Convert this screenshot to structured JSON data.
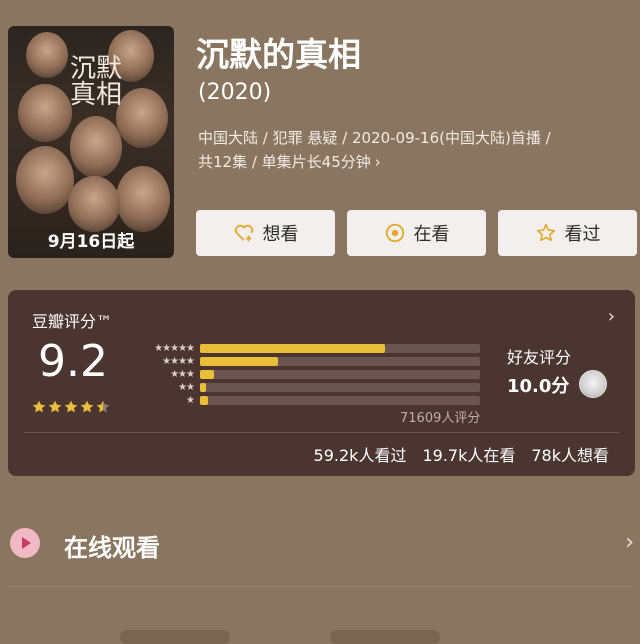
{
  "poster": {
    "title_art": "沉默真相",
    "date_text": "9月16日起"
  },
  "title": "沉默的真相",
  "year": "(2020)",
  "meta": {
    "line1": "中国大陆 / 犯罪 悬疑 / 2020-09-16(中国大陆)首播 /",
    "line2": "共12集 / 单集片长45分钟",
    "more_icon": "chevron-right-icon"
  },
  "actions": {
    "want": {
      "label": "想看",
      "icon": "heart-plus-icon"
    },
    "watching": {
      "label": "在看",
      "icon": "circle-dot-icon"
    },
    "watched": {
      "label": "看过",
      "icon": "star-outline-icon"
    }
  },
  "rating": {
    "label": "豆瓣评分™",
    "score": "9.2",
    "stars": 4.5,
    "distribution": [
      {
        "stars": 5,
        "fraction": 0.66
      },
      {
        "stars": 4,
        "fraction": 0.28
      },
      {
        "stars": 3,
        "fraction": 0.05
      },
      {
        "stars": 2,
        "fraction": 0.02
      },
      {
        "stars": 1,
        "fraction": 0.03
      }
    ],
    "votes": "71609人评分",
    "friend_label": "好友评分",
    "friend_score": "10.0分",
    "stats": {
      "watched": "59.2k人看过",
      "watching": "19.7k人在看",
      "want": "78k人想看"
    }
  },
  "online": {
    "label": "在线观看"
  },
  "colors": {
    "background": "#8a7560",
    "card": "#4b3530",
    "accent": "#e9bf3a",
    "button": "#f2efee"
  }
}
